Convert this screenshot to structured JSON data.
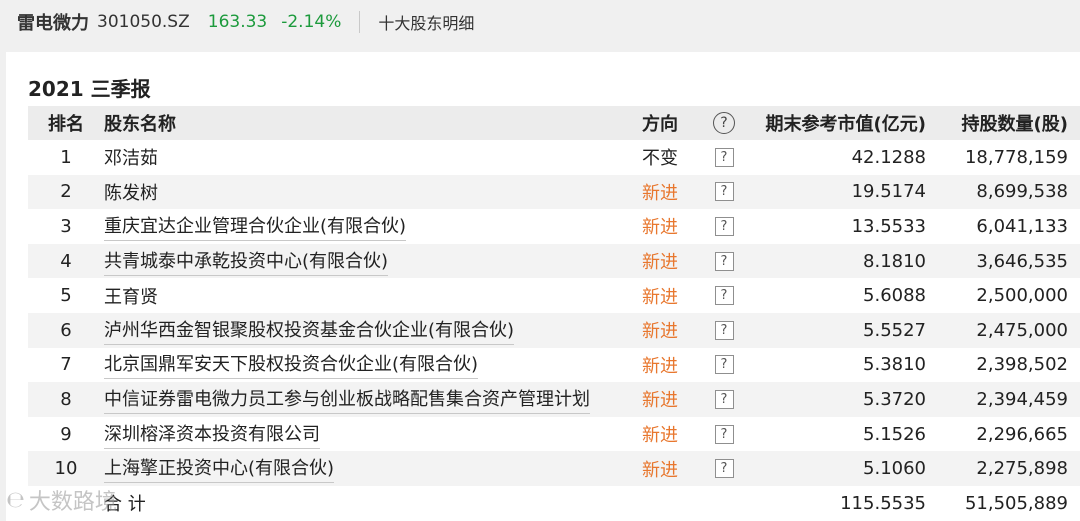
{
  "header": {
    "stock_name": "雷电微力",
    "stock_code": "301050.SZ",
    "price": "163.33",
    "change": "-2.14%",
    "tab": "十大股东明细"
  },
  "period": "2021 三季报",
  "columns": {
    "rank": "排名",
    "name": "股东名称",
    "direction": "方向",
    "help": "?",
    "market_value": "期末参考市值(亿元)",
    "shares": "持股数量(股)"
  },
  "rows": [
    {
      "rank": "1",
      "name": "邓洁茹",
      "direction": "不变",
      "mv": "42.1288",
      "shares": "18,778,159"
    },
    {
      "rank": "2",
      "name": "陈发树",
      "direction": "新进",
      "mv": "19.5174",
      "shares": "8,699,538"
    },
    {
      "rank": "3",
      "name": "重庆宜达企业管理合伙企业(有限合伙)",
      "direction": "新进",
      "mv": "13.5533",
      "shares": "6,041,133"
    },
    {
      "rank": "4",
      "name": "共青城泰中承乾投资中心(有限合伙)",
      "direction": "新进",
      "mv": "8.1810",
      "shares": "3,646,535"
    },
    {
      "rank": "5",
      "name": "王育贤",
      "direction": "新进",
      "mv": "5.6088",
      "shares": "2,500,000"
    },
    {
      "rank": "6",
      "name": "泸州华西金智银聚股权投资基金合伙企业(有限合伙)",
      "direction": "新进",
      "mv": "5.5527",
      "shares": "2,475,000"
    },
    {
      "rank": "7",
      "name": "北京国鼎军安天下股权投资合伙企业(有限合伙)",
      "direction": "新进",
      "mv": "5.3810",
      "shares": "2,398,502"
    },
    {
      "rank": "8",
      "name": "中信证券雷电微力员工参与创业板战略配售集合资产管理计划",
      "direction": "新进",
      "mv": "5.3720",
      "shares": "2,394,459"
    },
    {
      "rank": "9",
      "name": "深圳榕泽资本投资有限公司",
      "direction": "新进",
      "mv": "5.1526",
      "shares": "2,296,665"
    },
    {
      "rank": "10",
      "name": "上海擎正投资中心(有限合伙)",
      "direction": "新进",
      "mv": "5.1060",
      "shares": "2,275,898"
    }
  ],
  "total": {
    "label": "合 计",
    "mv": "115.5535",
    "shares": "51,505,889"
  },
  "watermark": "大数路境",
  "colors": {
    "up_green": "#1c9a3c",
    "new_orange": "#e8772e",
    "header_bg": "#ececec"
  }
}
